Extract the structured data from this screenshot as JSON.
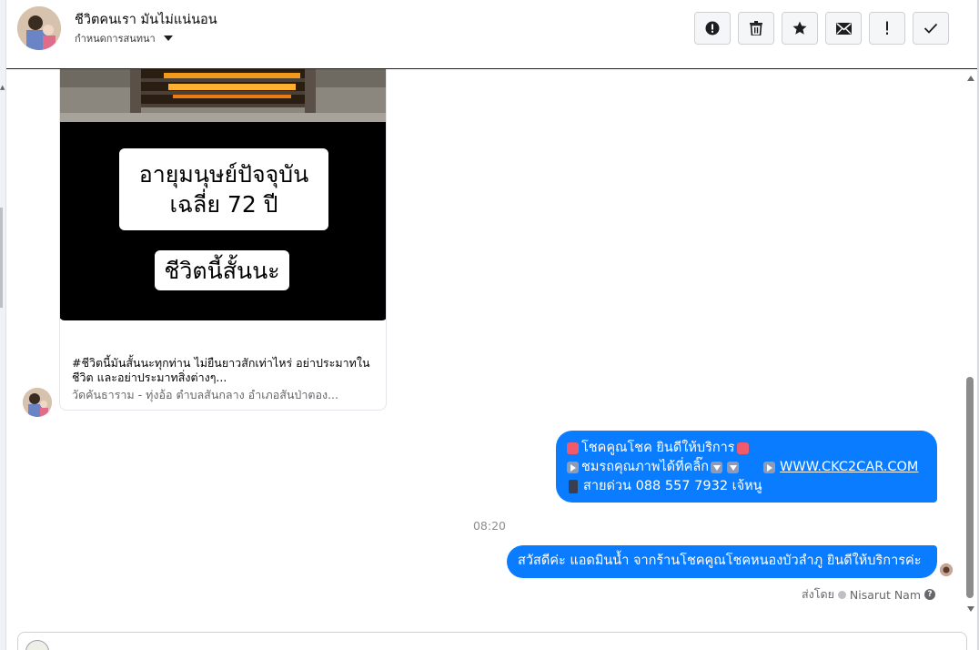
{
  "header": {
    "title": "ชีวิตคนเรา มันไม่แน่นอน",
    "subtitle": "กำหนดการสนทนา",
    "toolbar": [
      {
        "name": "alert-circle-button",
        "icon": "alert-circle-icon"
      },
      {
        "name": "delete-button",
        "icon": "trash-icon"
      },
      {
        "name": "star-button",
        "icon": "star-icon"
      },
      {
        "name": "mail-button",
        "icon": "envelope-icon"
      },
      {
        "name": "important-button",
        "icon": "exclamation-icon"
      },
      {
        "name": "done-button",
        "icon": "checkmark-icon"
      }
    ]
  },
  "shared_post": {
    "overlay_line1": "อายุมนุษย์ปัจจุบัน",
    "overlay_line2": "เฉลี่ย 72 ปี",
    "overlay_line3": "ชีวิตนี้สั้นนะ",
    "description": "#ชีวิตนี้มันสั้นนะทุกท่าน ไม่ยืนยาวสักเท่าไหร่ อย่าประมาทในชีวิต และอย่าประมาทสิ่งต่างๆ...",
    "source": "วัดคันธาราม - ทุ่งอ้อ ตำบลสันกลาง อำเภอสันป่าตอง..."
  },
  "messages": {
    "outgoing_1": {
      "line1": "โชคคูณโชค ยินดีให้บริการ",
      "line2_text": "ชมรถคุณภาพได้ที่คลิ๊ก",
      "line2_link": "WWW.CKC2CAR.COM",
      "line3": "สายด่วน 088 557 7932 เจ้หนู"
    },
    "timestamp": "08:20",
    "outgoing_2": "สวัสดีค่ะ แอดมินน้ำ จากร้านโชคคูณโชคหนองบัวลำภู ยินดีให้บริการค่ะ",
    "sent_by_label": "ส่งโดย",
    "sent_by_name": "Nisarut Nam"
  },
  "colors": {
    "bubble": "#0a7cff",
    "header_border": "#1c1e21",
    "muted_text": "#65676b"
  }
}
